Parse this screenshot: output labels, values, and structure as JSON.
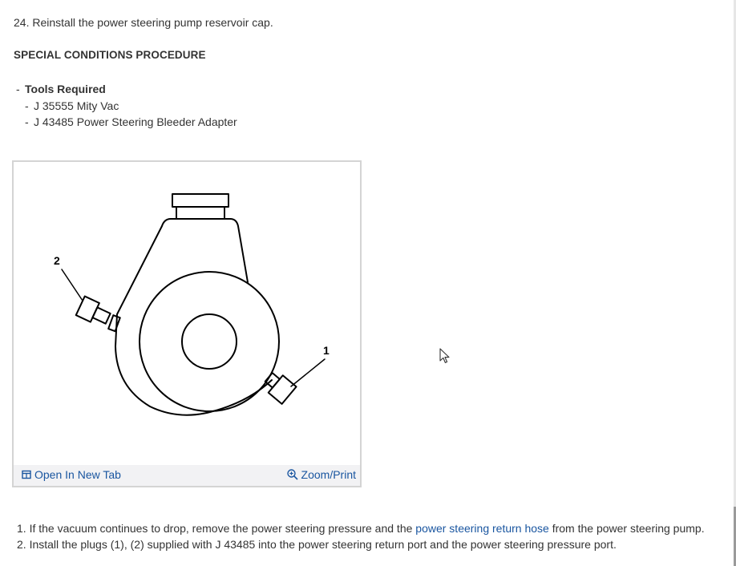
{
  "step_24": "24. Reinstall the power steering pump reservoir cap.",
  "section_heading": "SPECIAL CONDITIONS PROCEDURE",
  "tools": {
    "dash": "-",
    "heading": "Tools Required",
    "items": [
      "J 35555 Mity Vac",
      "J 43485 Power Steering Bleeder Adapter"
    ]
  },
  "figure": {
    "callouts": [
      "2",
      "1"
    ],
    "open_label": "Open In New Tab",
    "zoom_label": "Zoom/Print",
    "open_icon": "open-new-tab-icon",
    "zoom_icon": "zoom-in-icon"
  },
  "steps": {
    "step1_prefix": "1. If the vacuum continues to drop, remove the power steering pressure and the ",
    "step1_link": "power steering return hose",
    "step1_suffix": " from the power steering pump.",
    "step2": "2. Install the plugs (1), (2) supplied with J 43485 into the power steering return port and the power steering pressure port."
  },
  "colors": {
    "text": "#333333",
    "link": "#1a56a0",
    "figure_border": "#d4d4d4",
    "figure_bar": "#f2f2f4"
  }
}
